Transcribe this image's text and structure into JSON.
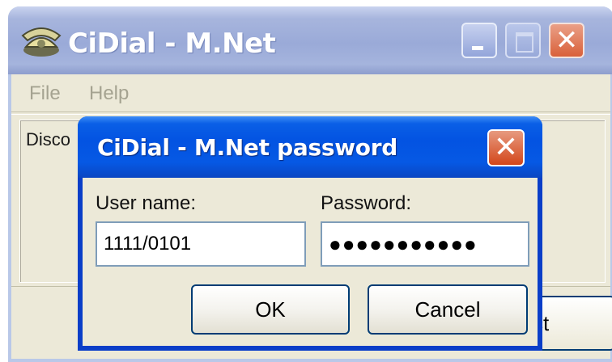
{
  "main_window": {
    "title": "CiDial - M.Net",
    "status_text": "Disco",
    "connect_button_label": "ct",
    "menu": [
      {
        "label": "File"
      },
      {
        "label": "Help"
      }
    ],
    "titlebar_buttons": {
      "minimize_icon": "minimize-icon",
      "maximize_icon": "maximize-icon",
      "close_glyph": "✕"
    }
  },
  "dialog": {
    "title": "CiDial - M.Net password",
    "close_glyph": "✕",
    "username_label": "User name:",
    "username_value": "1111/0101",
    "password_label": "Password:",
    "password_value": "●●●●●●●●●●●",
    "ok_label": "OK",
    "cancel_label": "Cancel"
  },
  "colors": {
    "dialog_titlebar": "#0353e2",
    "main_titlebar_inactive": "#9aaad8",
    "close_button": "#d9603a",
    "window_face": "#ece9d8"
  }
}
